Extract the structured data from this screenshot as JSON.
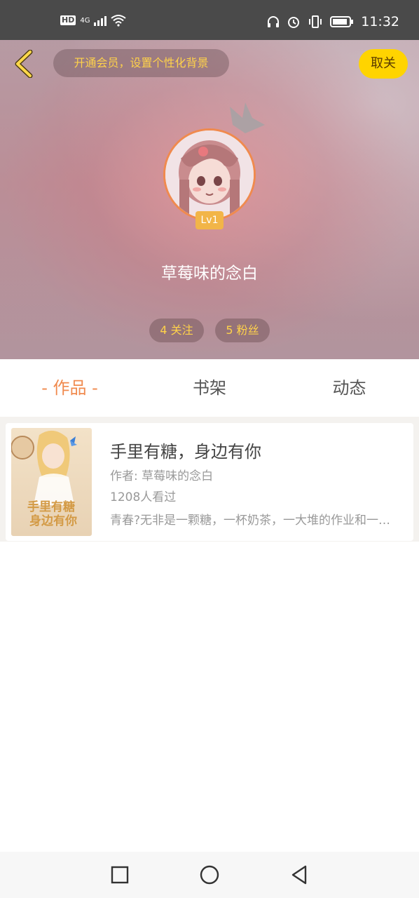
{
  "status_bar": {
    "hd": "HD",
    "network": "4G",
    "time": "11:32",
    "icons": [
      "signal-icon",
      "wifi-icon",
      "headphones-icon",
      "alarm-icon",
      "vibrate-icon",
      "battery-icon"
    ]
  },
  "header": {
    "vip_banner": "开通会员，设置个性化背景",
    "cancel_follow": "取关",
    "level": "Lv1",
    "username": "草莓味的念白",
    "following": "4 关注",
    "followers": "5 粉丝"
  },
  "tabs": [
    {
      "label": "- 作品 -",
      "active": true
    },
    {
      "label": "书架",
      "active": false
    },
    {
      "label": "动态",
      "active": false
    }
  ],
  "books": [
    {
      "title": "手里有糖，身边有你",
      "author": "作者: 草莓味的念白",
      "views": "1208人看过",
      "description": "青春?无非是一颗糖，一杯奶茶，一大堆的作业和一个你",
      "cover_text": "手里有糖身边有你"
    }
  ],
  "colors": {
    "accent_orange": "#f08a4e",
    "vip_yellow": "#ffd24a",
    "button_yellow": "#ffd400",
    "status_bar": "#4a4a4a"
  }
}
